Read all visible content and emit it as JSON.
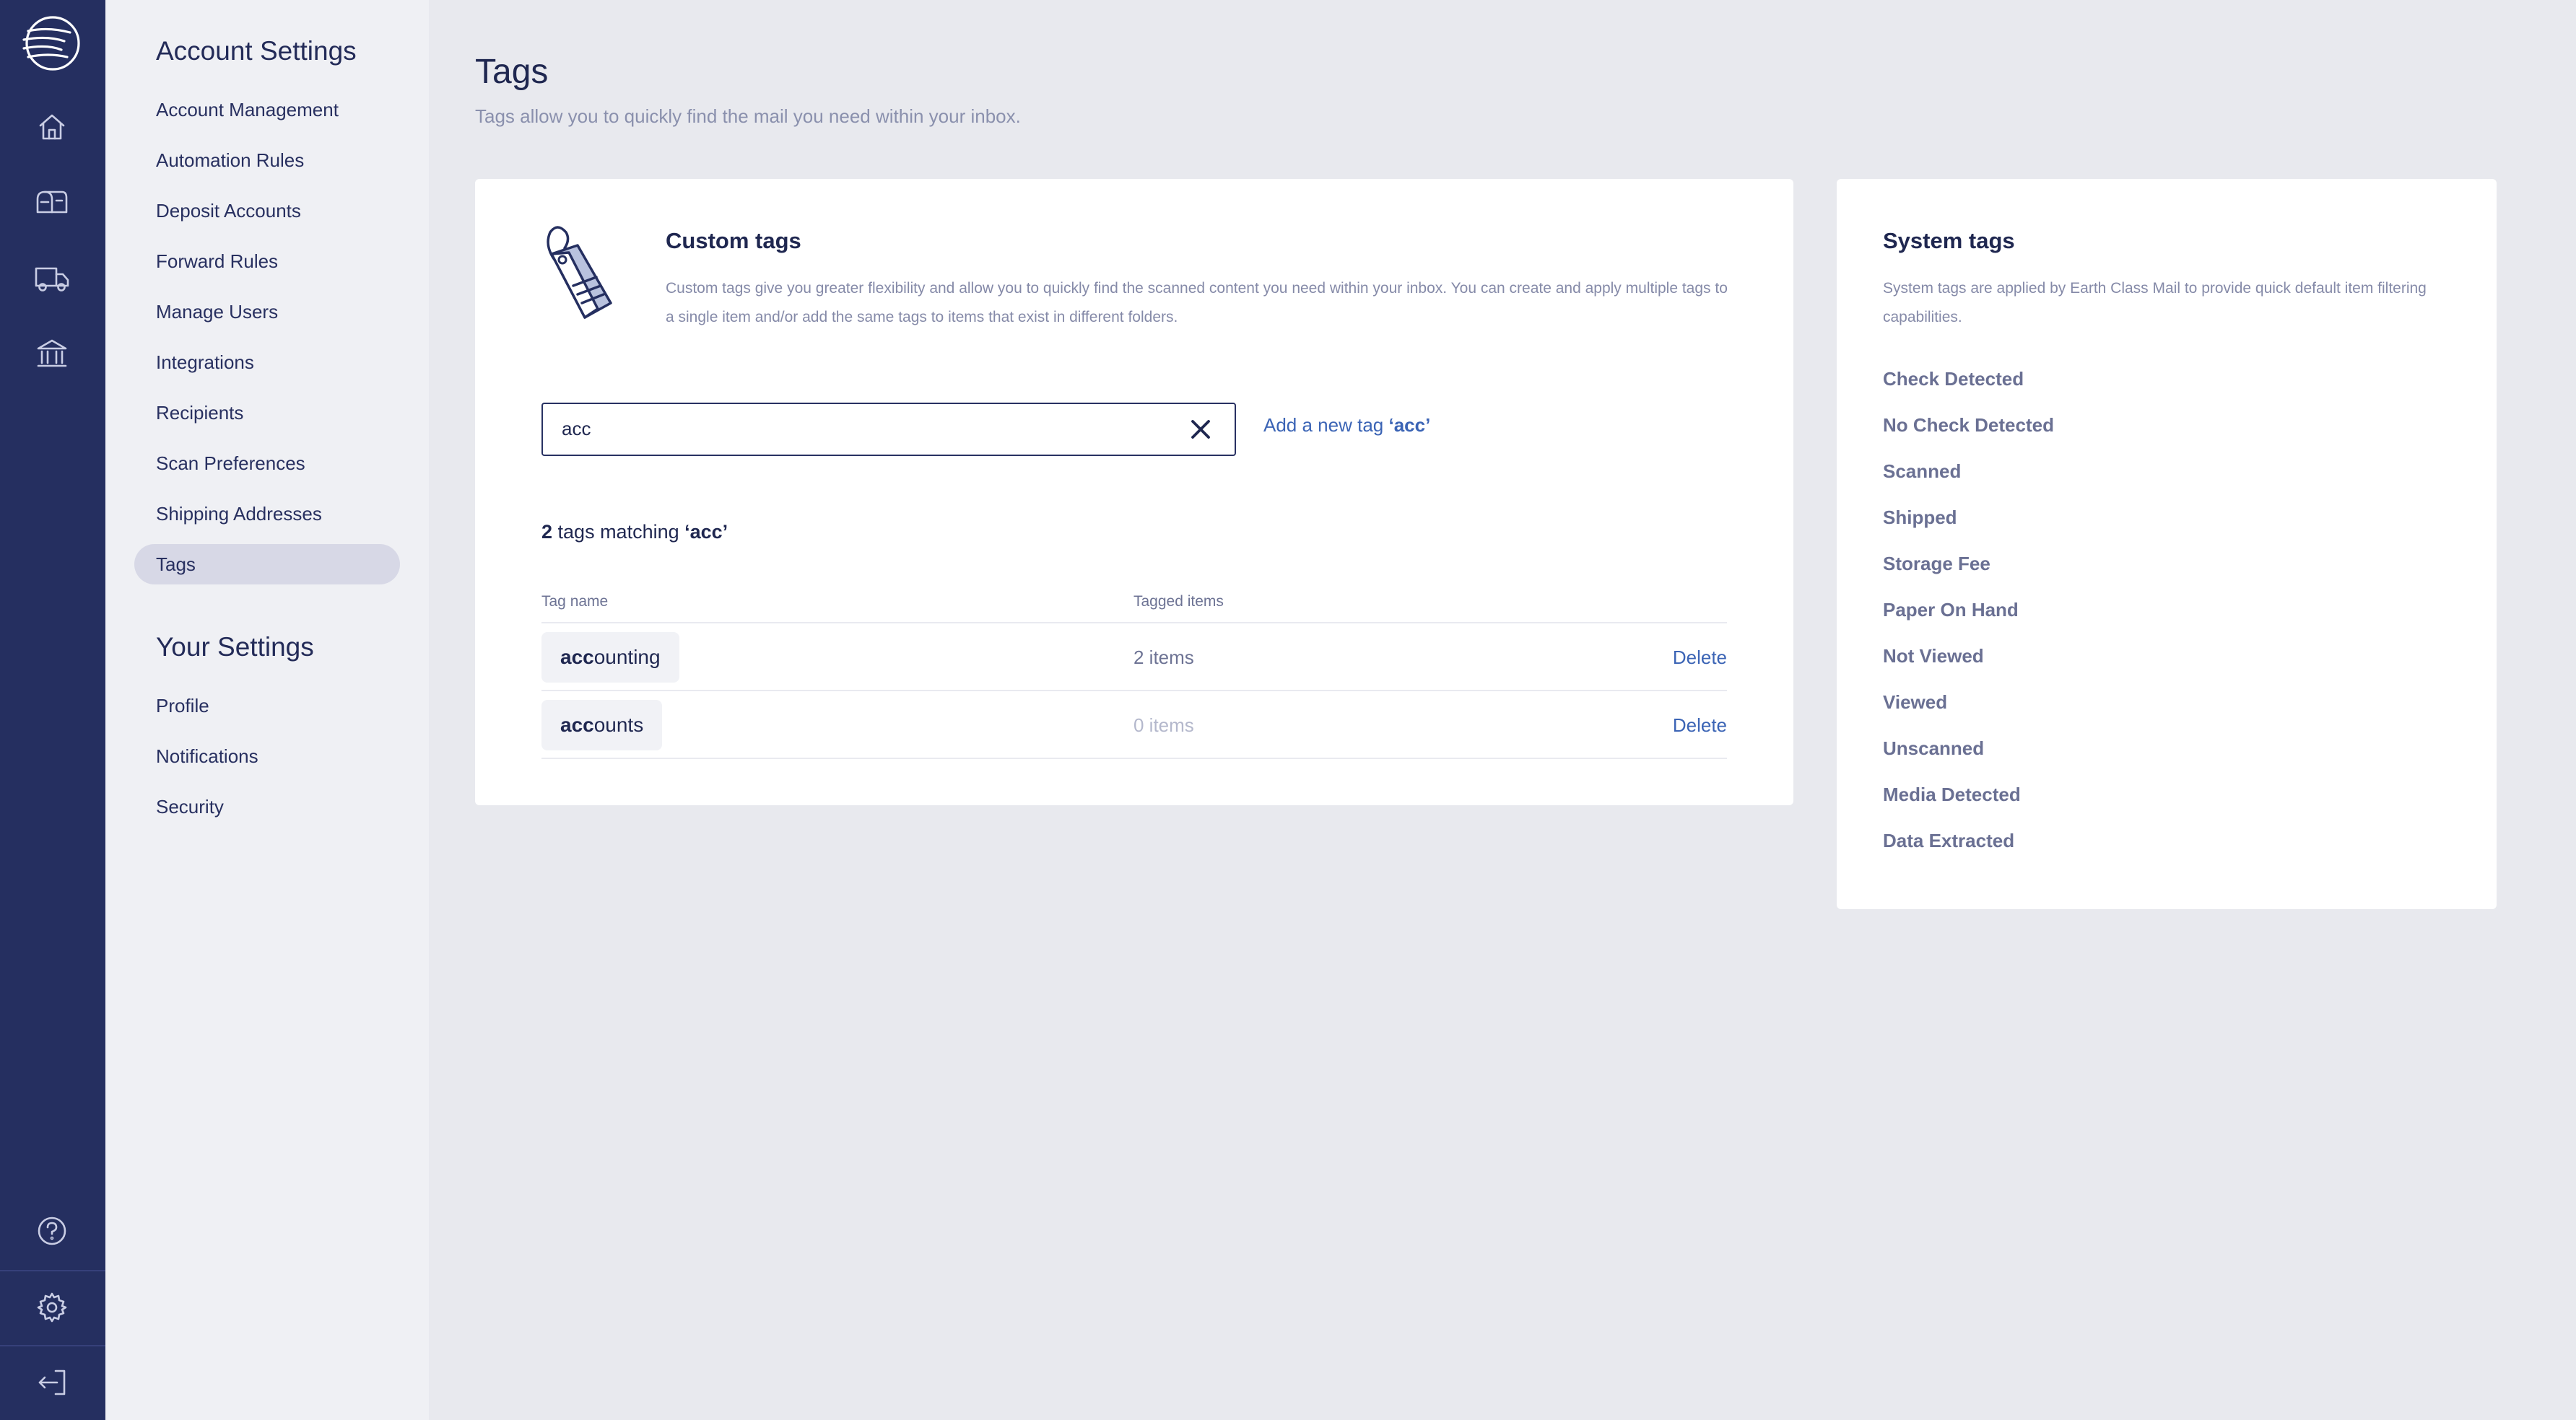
{
  "sidebar": {
    "account_settings_title": "Account Settings",
    "account_items": [
      {
        "label": "Account Management"
      },
      {
        "label": "Automation Rules"
      },
      {
        "label": "Deposit Accounts"
      },
      {
        "label": "Forward Rules"
      },
      {
        "label": "Manage Users"
      },
      {
        "label": "Integrations"
      },
      {
        "label": "Recipients"
      },
      {
        "label": "Scan Preferences"
      },
      {
        "label": "Shipping Addresses"
      },
      {
        "label": "Tags",
        "active": true
      }
    ],
    "your_settings_title": "Your Settings",
    "your_items": [
      {
        "label": "Profile"
      },
      {
        "label": "Notifications"
      },
      {
        "label": "Security"
      }
    ]
  },
  "rail": {
    "icons": [
      "logo-icon",
      "home-icon",
      "mailbox-icon",
      "truck-icon",
      "bank-icon",
      "help-icon",
      "gear-icon",
      "logout-icon"
    ]
  },
  "page": {
    "title": "Tags",
    "subtitle": "Tags allow you to quickly find the mail you need within your inbox."
  },
  "custom_tags": {
    "title": "Custom tags",
    "description": "Custom tags give you greater flexibility and allow you to quickly find the scanned content you need within your inbox. You can create and apply multiple tags to a single item and/or add the same tags to items that exist in different folders.",
    "search_value": "acc",
    "add_link_prefix": "Add a new tag ",
    "add_link_term": "‘acc’",
    "match_count": "2",
    "match_text": " tags matching ",
    "match_term": "‘acc’",
    "columns": {
      "tag_name": "Tag name",
      "tagged_items": "Tagged items"
    },
    "rows": [
      {
        "match": "acc",
        "rest": "ounting",
        "count": "2 items",
        "count_color": "#6d7394",
        "action": "Delete"
      },
      {
        "match": "acc",
        "rest": "ounts",
        "count": "0 items",
        "count_color": "#b4b8cc",
        "action": "Delete"
      }
    ]
  },
  "system_tags": {
    "title": "System tags",
    "description": "System tags are applied by Earth Class Mail to provide quick default item filtering capabilities.",
    "items": [
      "Check Detected",
      "No Check Detected",
      "Scanned",
      "Shipped",
      "Storage Fee",
      "Paper On Hand",
      "Not Viewed",
      "Viewed",
      "Unscanned",
      "Media Detected",
      "Data Extracted"
    ]
  },
  "colors": {
    "rail_bg": "#252f60",
    "accent_link": "#3b64b5",
    "active_menu_bg": "#d7d8e6"
  }
}
